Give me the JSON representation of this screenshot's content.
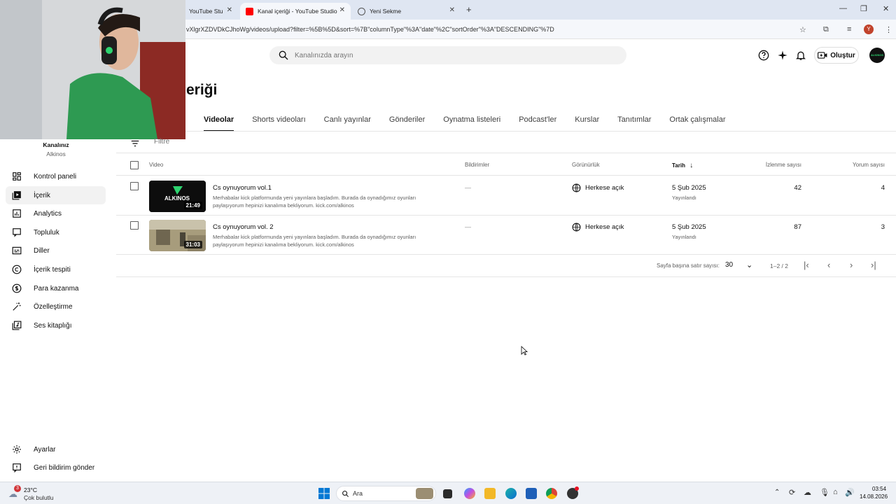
{
  "browser": {
    "tabs": [
      {
        "title": "YouTube Stu",
        "active": false
      },
      {
        "title": "Kanal içeriği - YouTube Studio",
        "active": true
      },
      {
        "title": "Yeni Sekme",
        "active": false
      }
    ],
    "url": "vXlgrXZDVDkCJhoWg/videos/upload?filter=%5B%5D&sort=%7B\"columnType\"%3A\"date\"%2C\"sortOrder\"%3A\"DESCENDING\"%7D",
    "profile_initial": "Y"
  },
  "header": {
    "search_placeholder": "Kanalınızda arayın",
    "create_label": "Oluştur",
    "avatar_text": "ALKINOS"
  },
  "page": {
    "title": "eriği",
    "tabs": [
      "Videolar",
      "Shorts videoları",
      "Canlı yayınlar",
      "Gönderiler",
      "Oynatma listeleri",
      "Podcast'ler",
      "Kurslar",
      "Tanıtımlar",
      "Ortak çalışmalar"
    ],
    "active_tab": "Videolar"
  },
  "sidebar": {
    "channel_label": "Kanalınız",
    "channel_name": "Alkinos",
    "items": [
      {
        "label": "Kontrol paneli",
        "icon": "dashboard-icon",
        "active": false
      },
      {
        "label": "İçerik",
        "icon": "content-icon",
        "active": true
      },
      {
        "label": "Analytics",
        "icon": "analytics-icon",
        "active": false
      },
      {
        "label": "Topluluk",
        "icon": "community-icon",
        "active": false
      },
      {
        "label": "Diller",
        "icon": "subtitles-icon",
        "active": false
      },
      {
        "label": "İçerik tespiti",
        "icon": "copyright-icon",
        "active": false
      },
      {
        "label": "Para kazanma",
        "icon": "dollar-icon",
        "active": false
      },
      {
        "label": "Özelleştirme",
        "icon": "magic-wand-icon",
        "active": false
      },
      {
        "label": "Ses kitaplığı",
        "icon": "audio-library-icon",
        "active": false
      }
    ],
    "bottom": [
      {
        "label": "Ayarlar",
        "icon": "gear-icon"
      },
      {
        "label": "Geri bildirim gönder",
        "icon": "feedback-icon"
      }
    ]
  },
  "table": {
    "filter_placeholder": "Filtre",
    "columns": {
      "video": "Video",
      "notifications": "Bildirimler",
      "visibility": "Görünürlük",
      "date": "Tarih",
      "views": "İzlenme sayısı",
      "comments": "Yorum sayısı"
    },
    "rows": [
      {
        "title": "Cs oynuyorum vol.1",
        "description": "Merhabalar kick platformunda yeni yayınlara başladım. Burada da oynadığımız oyunları paylaşıyorum hepinizi kanalıma bekliyorum. kick.com/alkinos",
        "duration": "21:49",
        "thumb_text": "ALKINOS",
        "notifications": "—",
        "visibility": "Herkese açık",
        "date": "5 Şub 2025",
        "status": "Yayınlandı",
        "views": "42",
        "comments": "4"
      },
      {
        "title": "Cs oynuyorum vol. 2",
        "description": "Merhabalar kick platformunda yeni yayınlara başladım. Burada da oynadığımız oyunları paylaşıyorum hepinizi kanalıma bekliyorum. kick.com/alkinos",
        "duration": "31:03",
        "thumb_text": "",
        "notifications": "—",
        "visibility": "Herkese açık",
        "date": "5 Şub 2025",
        "status": "Yayınlandı",
        "views": "87",
        "comments": "3"
      }
    ],
    "pager": {
      "rows_label": "Sayfa başına satır sayısı:",
      "rows_value": "30",
      "range": "1–2 / 2"
    }
  },
  "taskbar": {
    "weather_temp": "23°C",
    "weather_text": "Çok bulutlu",
    "weather_badge": "3",
    "search_label": "Ara",
    "time": "03:54",
    "date": "14.08.2026"
  },
  "colors": {
    "youtube_red": "#ff0000",
    "accent_green": "#2dd36f",
    "tab_bar": "#dfe6f2"
  }
}
